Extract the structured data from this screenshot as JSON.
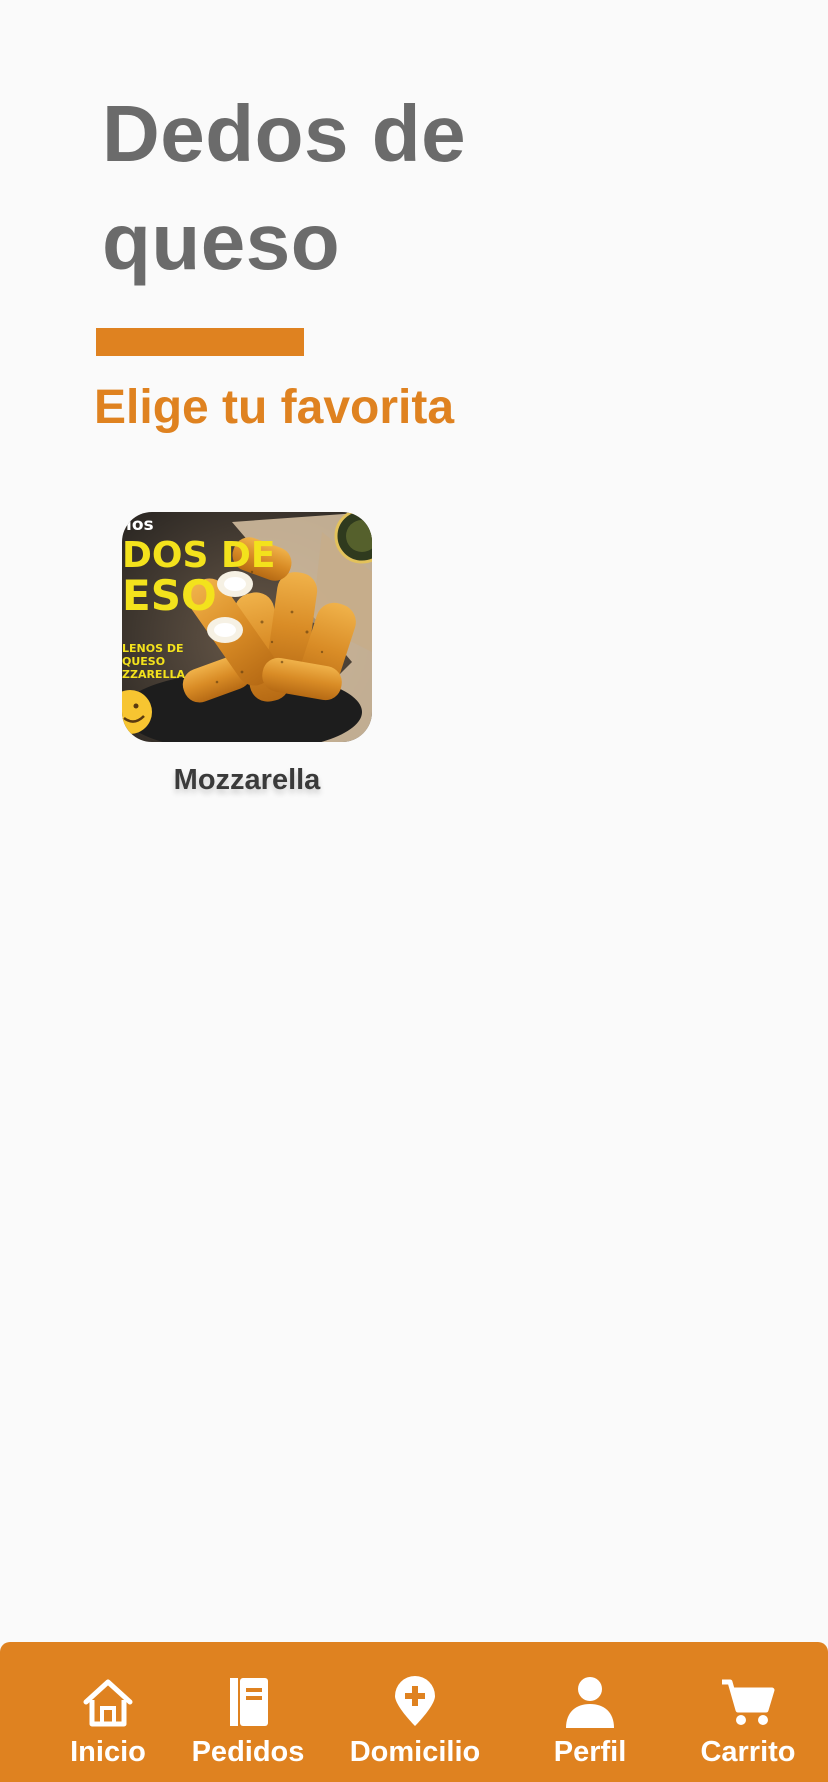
{
  "page": {
    "title": "Dedos de queso",
    "subtitle": "Elige tu favorita"
  },
  "products": [
    {
      "name": "Mozzarella",
      "image_text": {
        "line1": "los",
        "line2": "DOS DE",
        "line3": "ESO",
        "line4": "LENOS DE",
        "line5": "QUESO",
        "line6": "ZZARELLA"
      }
    }
  ],
  "nav": {
    "items": [
      {
        "label": "Inicio",
        "icon": "home-icon"
      },
      {
        "label": "Pedidos",
        "icon": "book-icon"
      },
      {
        "label": "Domicilio",
        "icon": "location-plus-icon"
      },
      {
        "label": "Perfil",
        "icon": "person-icon"
      },
      {
        "label": "Carrito",
        "icon": "cart-icon"
      }
    ]
  },
  "colors": {
    "accent": "#df8220",
    "title_gray": "#6b6b6b",
    "background": "#fafafa"
  }
}
